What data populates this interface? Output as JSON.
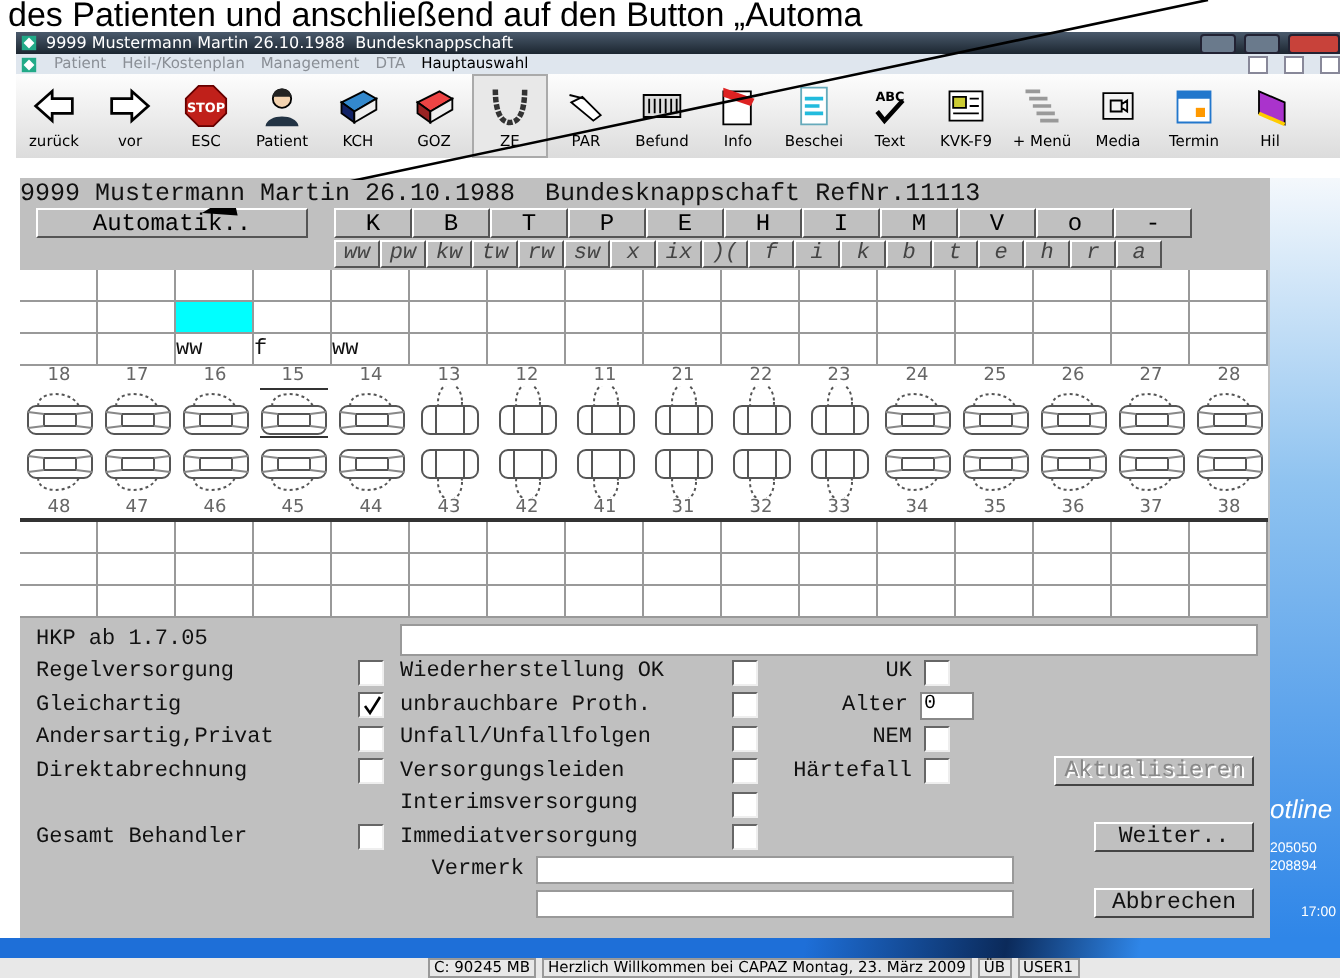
{
  "caption": "des Patienten und anschließend auf den Button „Automa",
  "window": {
    "title": "9999 Mustermann Martin 26.10.1988  Bundesknappschaft"
  },
  "menu": [
    {
      "label": "Patient",
      "disabled": true
    },
    {
      "label": "Heil-/Kostenplan",
      "disabled": true
    },
    {
      "label": "Management",
      "disabled": true
    },
    {
      "label": "DTA",
      "disabled": true
    },
    {
      "label": "Hauptauswahl",
      "disabled": false
    }
  ],
  "toolbar": [
    {
      "label": "zurück",
      "selected": false
    },
    {
      "label": "vor",
      "selected": false
    },
    {
      "label": "ESC",
      "selected": false,
      "icon_text": "STOP"
    },
    {
      "label": "Patient",
      "selected": false
    },
    {
      "label": "KCH",
      "selected": false
    },
    {
      "label": "GOZ",
      "selected": false
    },
    {
      "label": "ZE",
      "selected": true
    },
    {
      "label": "PAR",
      "selected": false
    },
    {
      "label": "Befund",
      "selected": false
    },
    {
      "label": "Info",
      "selected": false
    },
    {
      "label": "Beschei",
      "selected": false
    },
    {
      "label": "Text",
      "selected": false,
      "icon_text": "ABC"
    },
    {
      "label": "KVK-F9",
      "selected": false
    },
    {
      "label": "+ Menü",
      "selected": false
    },
    {
      "label": "Media",
      "selected": false
    },
    {
      "label": "Termin",
      "selected": false
    },
    {
      "label": "Hil",
      "selected": false
    }
  ],
  "patient_header": "9999 Mustermann Martin 26.10.1988  Bundesknappschaft RefNr.11113",
  "automatik_button": "Automatik..",
  "tabs_primary": [
    "K",
    "B",
    "T",
    "P",
    "E",
    "H",
    "I",
    "M",
    "V",
    "o",
    "-"
  ],
  "tabs_secondary": [
    "ww",
    "pw",
    "kw",
    "tw",
    "rw",
    "sw",
    "x",
    "ix",
    ")(",
    "f",
    "i",
    "k",
    "b",
    "t",
    "e",
    "h",
    "r",
    "a"
  ],
  "grid_rows": [
    {
      "cells": [
        {
          "selected": false
        },
        {
          "selected": false
        },
        {
          "selected": false
        },
        {
          "selected": false
        },
        {
          "selected": false
        },
        {
          "selected": false
        },
        {
          "selected": false
        },
        {
          "selected": false
        },
        {
          "selected": false
        },
        {
          "selected": false
        },
        {
          "selected": false
        },
        {
          "selected": false
        },
        {
          "selected": false
        },
        {
          "selected": false
        },
        {
          "selected": false
        },
        {
          "selected": false
        }
      ]
    },
    {
      "cells": [
        {
          "selected": false
        },
        {
          "selected": false
        },
        {
          "selected": true
        },
        {
          "selected": false
        },
        {
          "selected": false
        },
        {
          "selected": false
        },
        {
          "selected": false
        },
        {
          "selected": false
        },
        {
          "selected": false
        },
        {
          "selected": false
        },
        {
          "selected": false
        },
        {
          "selected": false
        },
        {
          "selected": false
        },
        {
          "selected": false
        },
        {
          "selected": false
        },
        {
          "selected": false
        }
      ]
    },
    {
      "cells": [
        {
          "selected": false
        },
        {
          "selected": false
        },
        {
          "text": "ww",
          "selected": false
        },
        {
          "text": "f",
          "selected": false
        },
        {
          "text": "ww",
          "selected": false
        },
        {
          "selected": false
        },
        {
          "selected": false
        },
        {
          "selected": false
        },
        {
          "selected": false
        },
        {
          "selected": false
        },
        {
          "selected": false
        },
        {
          "selected": false
        },
        {
          "selected": false
        },
        {
          "selected": false
        },
        {
          "selected": false
        },
        {
          "selected": false
        }
      ]
    }
  ],
  "teeth_upper": [
    {
      "number": "18",
      "kind": "crown",
      "marked": false
    },
    {
      "number": "17",
      "kind": "crown",
      "marked": false
    },
    {
      "number": "16",
      "kind": "crown",
      "marked": false
    },
    {
      "number": "15",
      "kind": "crown",
      "marked": true
    },
    {
      "number": "14",
      "kind": "crown",
      "marked": false
    },
    {
      "number": "13",
      "kind": "natural",
      "marked": false
    },
    {
      "number": "12",
      "kind": "natural",
      "marked": false
    },
    {
      "number": "11",
      "kind": "natural",
      "marked": false
    },
    {
      "number": "21",
      "kind": "natural",
      "marked": false
    },
    {
      "number": "22",
      "kind": "natural",
      "marked": false
    },
    {
      "number": "23",
      "kind": "natural",
      "marked": false
    },
    {
      "number": "24",
      "kind": "crown",
      "marked": false
    },
    {
      "number": "25",
      "kind": "crown",
      "marked": false
    },
    {
      "number": "26",
      "kind": "crown",
      "marked": false
    },
    {
      "number": "27",
      "kind": "crown",
      "marked": false
    },
    {
      "number": "28",
      "kind": "crown",
      "marked": false
    }
  ],
  "teeth_lower": [
    {
      "number": "48",
      "kind": "crown"
    },
    {
      "number": "47",
      "kind": "crown"
    },
    {
      "number": "46",
      "kind": "crown"
    },
    {
      "number": "45",
      "kind": "crown"
    },
    {
      "number": "44",
      "kind": "crown"
    },
    {
      "number": "43",
      "kind": "natural"
    },
    {
      "number": "42",
      "kind": "natural"
    },
    {
      "number": "41",
      "kind": "natural"
    },
    {
      "number": "31",
      "kind": "natural"
    },
    {
      "number": "32",
      "kind": "natural"
    },
    {
      "number": "33",
      "kind": "natural"
    },
    {
      "number": "34",
      "kind": "crown"
    },
    {
      "number": "35",
      "kind": "crown"
    },
    {
      "number": "36",
      "kind": "crown"
    },
    {
      "number": "37",
      "kind": "crown"
    },
    {
      "number": "38",
      "kind": "crown"
    }
  ],
  "form": {
    "hkp_label": "HKP ab 1.7.05",
    "left": [
      {
        "label": "Regelversorgung",
        "checked": false
      },
      {
        "label": "Gleichartig",
        "checked": true
      },
      {
        "label": "Andersartig,Privat",
        "checked": false
      },
      {
        "label": "Direktabrechnung",
        "checked": false
      },
      {
        "label": "Gesamt Behandler",
        "checked": false
      }
    ],
    "middle": [
      {
        "label": "Wiederherstellung OK",
        "checked": false
      },
      {
        "label": "unbrauchbare Proth.",
        "checked": false
      },
      {
        "label": "Unfall/Unfallfolgen",
        "checked": false
      },
      {
        "label": "Versorgungsleiden",
        "checked": false
      },
      {
        "label": "Interimsversorgung",
        "checked": false
      },
      {
        "label": "Immediatversorgung",
        "checked": false
      }
    ],
    "right": [
      {
        "kind": "checkbox",
        "label": "UK",
        "checked": false
      },
      {
        "kind": "field",
        "label": "Alter",
        "value": "0"
      },
      {
        "kind": "checkbox",
        "label": "NEM",
        "checked": false
      },
      {
        "kind": "checkbox",
        "label": "Härtefall",
        "checked": false
      }
    ],
    "vermerk_label": "Vermerk",
    "buttons": [
      {
        "label": "Aktualisieren",
        "disabled": true
      },
      {
        "label": "Weiter..",
        "disabled": false
      },
      {
        "label": "Abbrechen",
        "disabled": false
      }
    ]
  },
  "desktop_texts": [
    "otline",
    "205050",
    "208894",
    "17:00"
  ],
  "status_bar": [
    "C: 90245 MB",
    "Herzlich Willkommen bei CAPAZ Montag, 23. März 2009",
    "ÜB",
    "USER1"
  ]
}
